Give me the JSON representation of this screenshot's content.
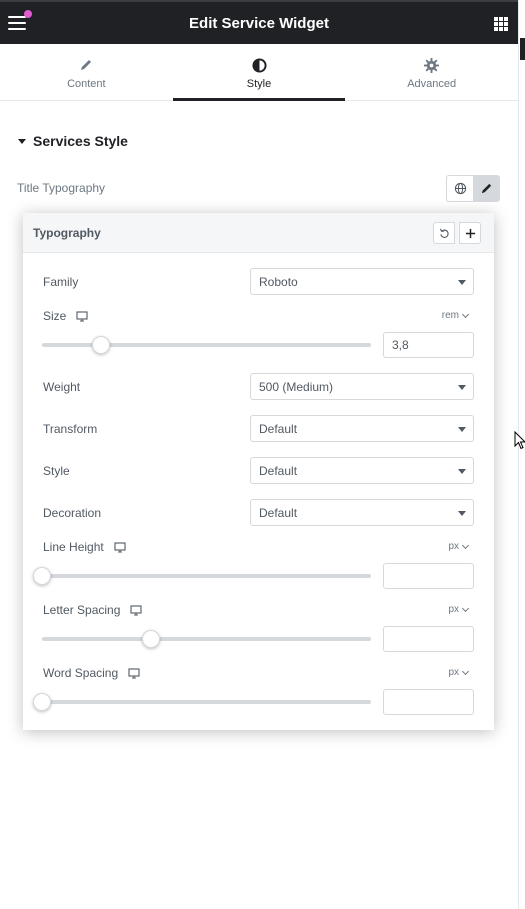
{
  "header": {
    "title": "Edit Service Widget",
    "menu_icon": "hamburger-icon",
    "apps_icon": "grid-icon"
  },
  "tabs": [
    {
      "label": "Content",
      "icon": "pencil-icon",
      "active": false
    },
    {
      "label": "Style",
      "icon": "half-circle-icon",
      "active": true
    },
    {
      "label": "Advanced",
      "icon": "gear-icon",
      "active": false
    }
  ],
  "section": {
    "title": "Services Style"
  },
  "control": {
    "label": "Title Typography"
  },
  "popover": {
    "title": "Typography",
    "family": {
      "label": "Family",
      "value": "Roboto"
    },
    "size": {
      "label": "Size",
      "unit": "rem",
      "value": "3,8",
      "slider_fraction": 0.18
    },
    "weight": {
      "label": "Weight",
      "value": "500 (Medium)"
    },
    "transform": {
      "label": "Transform",
      "value": "Default"
    },
    "style": {
      "label": "Style",
      "value": "Default"
    },
    "decoration": {
      "label": "Decoration",
      "value": "Default"
    },
    "line_height": {
      "label": "Line Height",
      "unit": "px",
      "value": "",
      "slider_fraction": 0.0
    },
    "letter_spacing": {
      "label": "Letter Spacing",
      "unit": "px",
      "value": "",
      "slider_fraction": 0.33
    },
    "word_spacing": {
      "label": "Word Spacing",
      "unit": "px",
      "value": "",
      "slider_fraction": 0.0
    }
  },
  "colors": {
    "topbar": "#1f2124",
    "accent_dot": "#e05cd0"
  }
}
